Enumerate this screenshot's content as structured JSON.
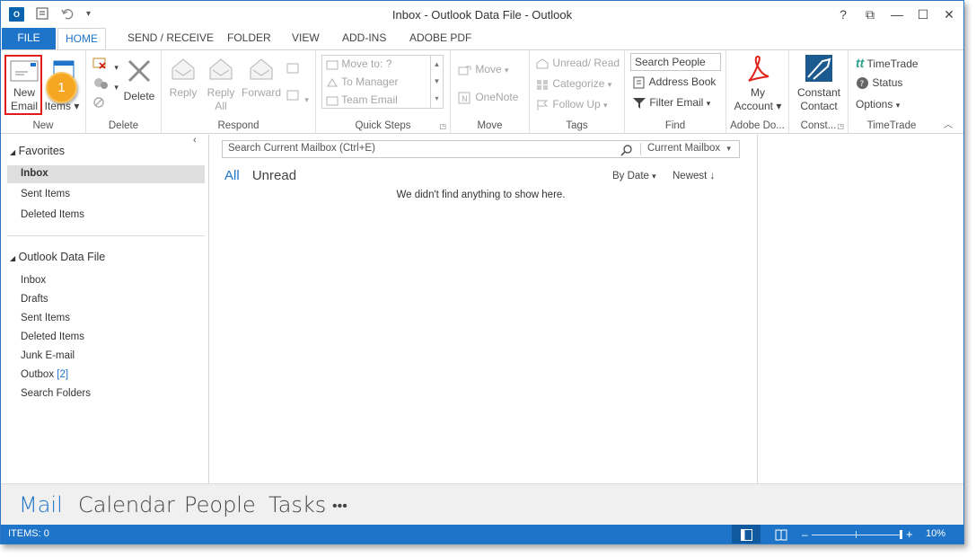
{
  "window": {
    "title": "Inbox - Outlook Data File - Outlook",
    "app_logo": "O",
    "controls": [
      "?",
      "⧉",
      "—",
      "☐",
      "✕"
    ]
  },
  "tabs": [
    "FILE",
    "HOME",
    "SEND / RECEIVE",
    "FOLDER",
    "VIEW",
    "ADD-INS",
    "ADOBE PDF"
  ],
  "ribbon": {
    "new": {
      "new_email": [
        "New",
        "Email"
      ],
      "new_items": "Items",
      "group": "New"
    },
    "delete": {
      "delete": "Delete",
      "group": "Delete"
    },
    "respond": {
      "reply": "Reply",
      "reply_all": [
        "Reply",
        "All"
      ],
      "forward": "Forward",
      "group": "Respond"
    },
    "quick_steps": {
      "items": [
        "Move to: ?",
        "To Manager",
        "Team Email"
      ],
      "group": "Quick Steps"
    },
    "move": {
      "move": "Move",
      "onenote": "OneNote",
      "group": "Move"
    },
    "tags": {
      "unread_read": "Unread/ Read",
      "categorize": "Categorize",
      "follow_up": "Follow Up",
      "group": "Tags"
    },
    "find": {
      "search_people_placeholder": "Search People",
      "address_book": "Address Book",
      "filter_email": "Filter Email",
      "group": "Find"
    },
    "adobe": {
      "my_account": [
        "My",
        "Account"
      ],
      "group": "Adobe Do..."
    },
    "constant_contact": {
      "label": [
        "Constant",
        "Contact"
      ],
      "group": "Const..."
    },
    "timetrade": {
      "timetrade": "TimeTrade",
      "status": "Status",
      "options": "Options",
      "group": "TimeTrade"
    }
  },
  "nav": {
    "favorites_header": "Favorites",
    "favorites": [
      "Inbox",
      "Sent Items",
      "Deleted Items"
    ],
    "datafile_header": "Outlook Data File",
    "folders": [
      "Inbox",
      "Drafts",
      "Sent Items",
      "Deleted Items",
      "Junk E-mail",
      "Outbox",
      "Search Folders"
    ],
    "outbox_count": "[2]"
  },
  "list": {
    "search_placeholder": "Search Current Mailbox (Ctrl+E)",
    "scope": "Current Mailbox",
    "filter_all": "All",
    "filter_unread": "Unread",
    "sort_by": "By Date",
    "sort_order": "Newest",
    "empty_message": "We didn't find anything to show here."
  },
  "bottom_nav": [
    "Mail",
    "Calendar",
    "People",
    "Tasks",
    "•••"
  ],
  "status": {
    "items": "ITEMS: 0",
    "zoom": "10%"
  },
  "callout": {
    "number": "1"
  },
  "colors": {
    "accent": "#1e74c8",
    "callout": "#f5a623",
    "highlight": "#e21b1b",
    "adobe_red": "#e2231a"
  }
}
